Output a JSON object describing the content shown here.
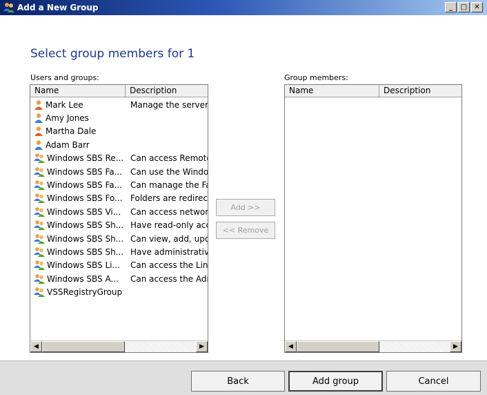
{
  "window": {
    "title": "Add a New Group",
    "title_icon": "group-icon"
  },
  "heading": "Select group members for 1",
  "left_panel": {
    "label": "Users and groups:",
    "columns": [
      "Name",
      "Description"
    ],
    "rows": [
      {
        "name": "Mark Lee",
        "description": "Manage the server",
        "icon": "admin-user-icon"
      },
      {
        "name": "Amy Jones",
        "description": "",
        "icon": "user-icon"
      },
      {
        "name": "Martha Dale",
        "description": "",
        "icon": "admin-user-icon"
      },
      {
        "name": "Adam Barr",
        "description": "",
        "icon": "user-icon"
      },
      {
        "name": "Windows SBS Re...",
        "description": "Can access Remote",
        "icon": "group-icon"
      },
      {
        "name": "Windows SBS Fa...",
        "description": "Can use the Windo",
        "icon": "group-icon"
      },
      {
        "name": "Windows SBS Fa...",
        "description": "Can manage the Fa",
        "icon": "group-icon"
      },
      {
        "name": "Windows SBS Fo...",
        "description": "Folders are redirect",
        "icon": "group-icon"
      },
      {
        "name": "Windows SBS Vi...",
        "description": "Can access networl",
        "icon": "group-icon"
      },
      {
        "name": "Windows SBS Sh...",
        "description": "Have read-only acc",
        "icon": "group-icon"
      },
      {
        "name": "Windows SBS Sh...",
        "description": "Can view, add, upd",
        "icon": "group-icon"
      },
      {
        "name": "Windows SBS Sh...",
        "description": "Have administrative",
        "icon": "group-icon"
      },
      {
        "name": "Windows SBS Li...",
        "description": "Can access the Link",
        "icon": "group-icon"
      },
      {
        "name": "Windows SBS A...",
        "description": "Can access the Adm",
        "icon": "group-icon"
      },
      {
        "name": "VSSRegistryGroup",
        "description": "",
        "icon": "group-icon"
      }
    ]
  },
  "right_panel": {
    "label": "Group members:",
    "columns": [
      "Name",
      "Description"
    ]
  },
  "buttons": {
    "add": "Add >>",
    "remove": "<< Remove",
    "back": "Back",
    "add_group": "Add group",
    "cancel": "Cancel"
  }
}
